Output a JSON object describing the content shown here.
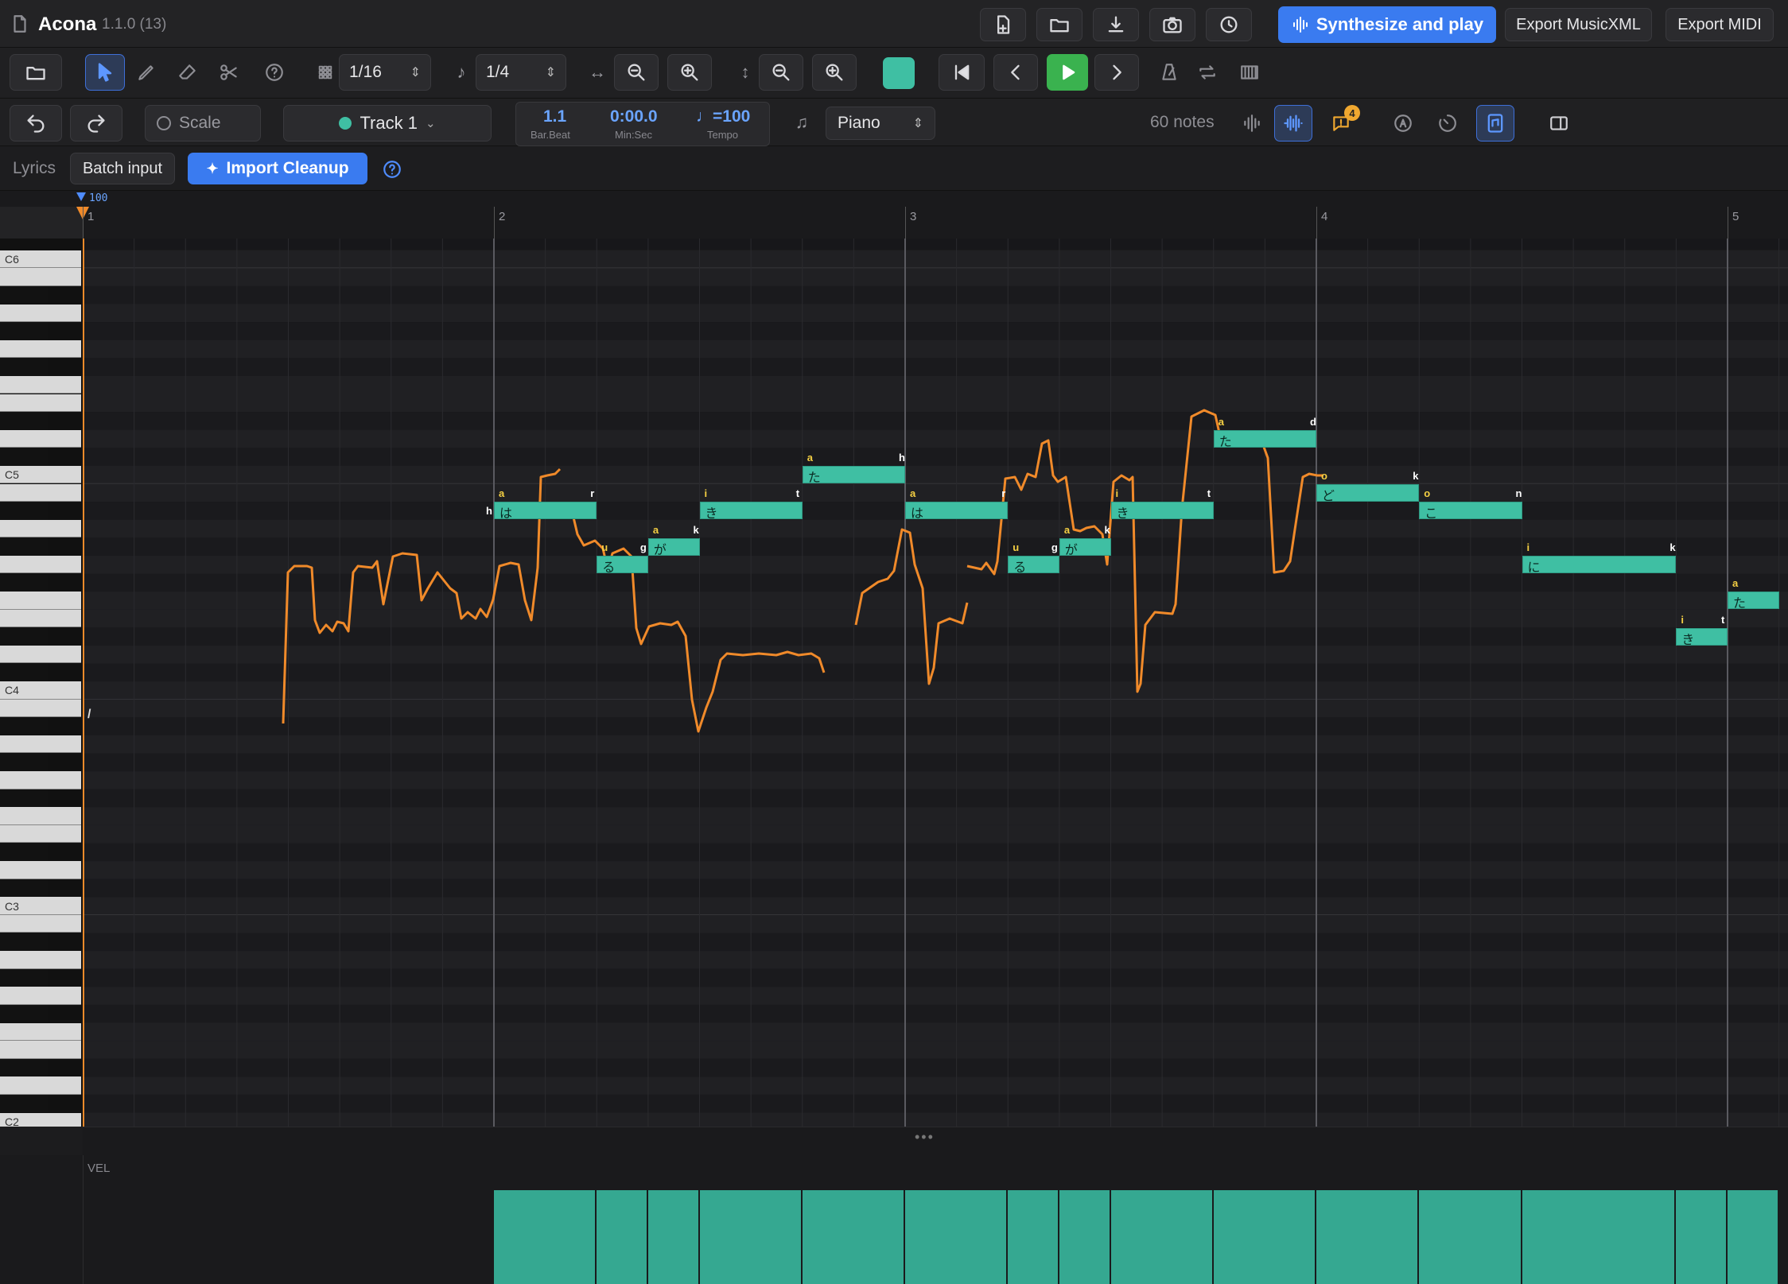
{
  "app": {
    "name": "Acona",
    "version": "1.1.0 (13)"
  },
  "header_buttons": {
    "synth": "Synthesize and play",
    "musicxml": "Export MusicXML",
    "midi": "Export MIDI"
  },
  "toolbar": {
    "grid": "1/16",
    "note_length": "1/4",
    "color": "#3fbfa3"
  },
  "toolbar2": {
    "scale": "Scale",
    "track": "Track 1",
    "position": "1.1",
    "position_caption": "Bar.Beat",
    "time": "0:00.0",
    "time_caption": "Min:Sec",
    "tempo": "♩=100",
    "tempo_caption": "Tempo",
    "instrument": "Piano",
    "note_count": "60 notes",
    "badge": "4"
  },
  "lyricsbar": {
    "lyrics": "Lyrics",
    "batch": "Batch input",
    "cleanup": "Import Cleanup"
  },
  "ruler": {
    "bars": [
      "1",
      "2",
      "3",
      "4",
      "5"
    ],
    "tempo_marker": "100"
  },
  "octaves": [
    "C6",
    "C5",
    "C4",
    "C3",
    "C2"
  ],
  "vel_label": "VEL",
  "marker": "/",
  "notes": [
    {
      "bar": 2.0,
      "len": 0.25,
      "pitch": 70,
      "lyric": "は",
      "ph_start": "h",
      "ph_start_y": false,
      "vowel": "a",
      "ph_end": "r"
    },
    {
      "bar": 2.25,
      "len": 0.125,
      "pitch": 67,
      "lyric": "る",
      "vowel": "u"
    },
    {
      "bar": 2.375,
      "len": 0.125,
      "pitch": 68,
      "lyric": "が",
      "ph_start": "g",
      "vowel": "a",
      "ph_end": "k"
    },
    {
      "bar": 2.5,
      "len": 0.25,
      "pitch": 70,
      "lyric": "き",
      "vowel": "i",
      "ph_end": "t"
    },
    {
      "bar": 2.75,
      "len": 0.25,
      "pitch": 72,
      "lyric": "た",
      "vowel": "a",
      "ph_end": "h"
    },
    {
      "bar": 3.0,
      "len": 0.25,
      "pitch": 70,
      "lyric": "は",
      "vowel": "a",
      "ph_end": "r"
    },
    {
      "bar": 3.25,
      "len": 0.125,
      "pitch": 67,
      "lyric": "る",
      "vowel": "u"
    },
    {
      "bar": 3.375,
      "len": 0.125,
      "pitch": 68,
      "lyric": "が",
      "ph_start": "g",
      "vowel": "a",
      "ph_end": "k"
    },
    {
      "bar": 3.5,
      "len": 0.25,
      "pitch": 70,
      "lyric": "き",
      "vowel": "i",
      "ph_end": "t"
    },
    {
      "bar": 3.75,
      "len": 0.25,
      "pitch": 74,
      "lyric": "た",
      "vowel": "a",
      "ph_end": "d"
    },
    {
      "bar": 4.0,
      "len": 0.25,
      "pitch": 71,
      "lyric": "ど",
      "vowel": "o",
      "ph_end": "k"
    },
    {
      "bar": 4.25,
      "len": 0.25,
      "pitch": 70,
      "lyric": "こ",
      "vowel": "o",
      "ph_end": "n"
    },
    {
      "bar": 4.5,
      "len": 0.375,
      "pitch": 67,
      "lyric": "に",
      "vowel": "i",
      "ph_end": "k"
    },
    {
      "bar": 4.875,
      "len": 0.125,
      "pitch": 63,
      "lyric": "き",
      "vowel": "i",
      "ph_end": "t"
    },
    {
      "bar": 5.0,
      "len": 0.125,
      "pitch": 65,
      "lyric": "た",
      "vowel": "a"
    }
  ]
}
